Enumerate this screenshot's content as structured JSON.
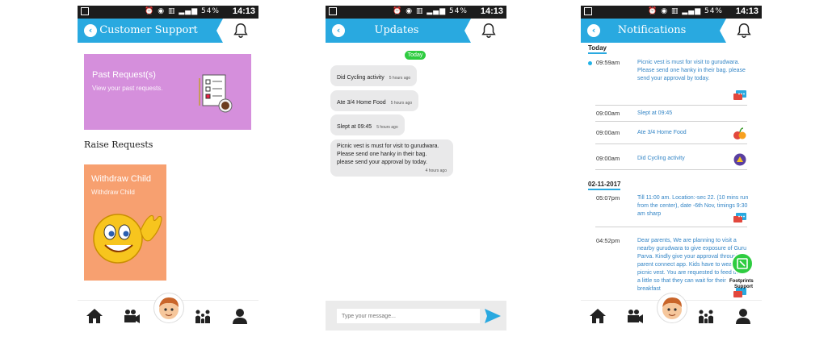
{
  "status_bar": {
    "battery": "54%",
    "time": "14:13"
  },
  "screens": [
    {
      "title": "Customer Support",
      "past_requests": {
        "title": "Past Request(s)",
        "subtitle": "View your past requests."
      },
      "raise_requests": "Raise Requests",
      "withdraw": {
        "title": "Withdraw Child",
        "subtitle": "Withdraw Child"
      }
    },
    {
      "title": "Updates",
      "today_badge": "Today",
      "messages": [
        {
          "text": "Did Cycling activity",
          "time": "5 hours ago"
        },
        {
          "text": "Ate 3/4 Home Food",
          "time": "5 hours ago"
        },
        {
          "text": "Slept at 09:45",
          "time": "5 hours ago"
        },
        {
          "lines": [
            "Picnic vest is must for visit to gurudwara.",
            "Please send one hanky in their bag.",
            "please send your approval by today."
          ],
          "time": "4 hours ago"
        }
      ],
      "composer_placeholder": "Type your message..."
    },
    {
      "title": "Notifications",
      "sections": [
        "Today",
        "02-11-2017"
      ],
      "items": [
        {
          "time": "09:59am",
          "text": "Picnic vest is must for visit to gurudwara. Please send one hanky in their bag. please send your approval by today.",
          "icon": "chat-icon"
        },
        {
          "time": "09:00am",
          "text": "Slept at 09:45",
          "icon": ""
        },
        {
          "time": "09:00am",
          "text": "Ate 3/4 Home Food",
          "icon": "fruit-icon"
        },
        {
          "time": "09:00am",
          "text": "Did Cycling activity",
          "icon": "activity-icon"
        },
        {
          "time": "05:07pm",
          "text": "Till 11:00 am. Location:-sec 22. (10 mins run from the center), date -6th Nov, timings 9:30 am sharp",
          "icon": "chat-icon"
        },
        {
          "time": "04:52pm",
          "text": "Dear parents, We are planning to visit a nearby gurudwara to give exposure of Guru Parva. Kindly give your approval through parent connect app. Kids have to wear picnic vest. You are requested to feed them a little so that they can wait for their breakfast",
          "icon": "chat-icon"
        }
      ],
      "footprints_label": [
        "Footprints",
        "Support"
      ]
    }
  ],
  "colors": {
    "header": "#29a9e0",
    "past": "#d58fdc",
    "withdraw": "#f7a070",
    "badge": "#2ecc40",
    "link": "#3385c6"
  }
}
